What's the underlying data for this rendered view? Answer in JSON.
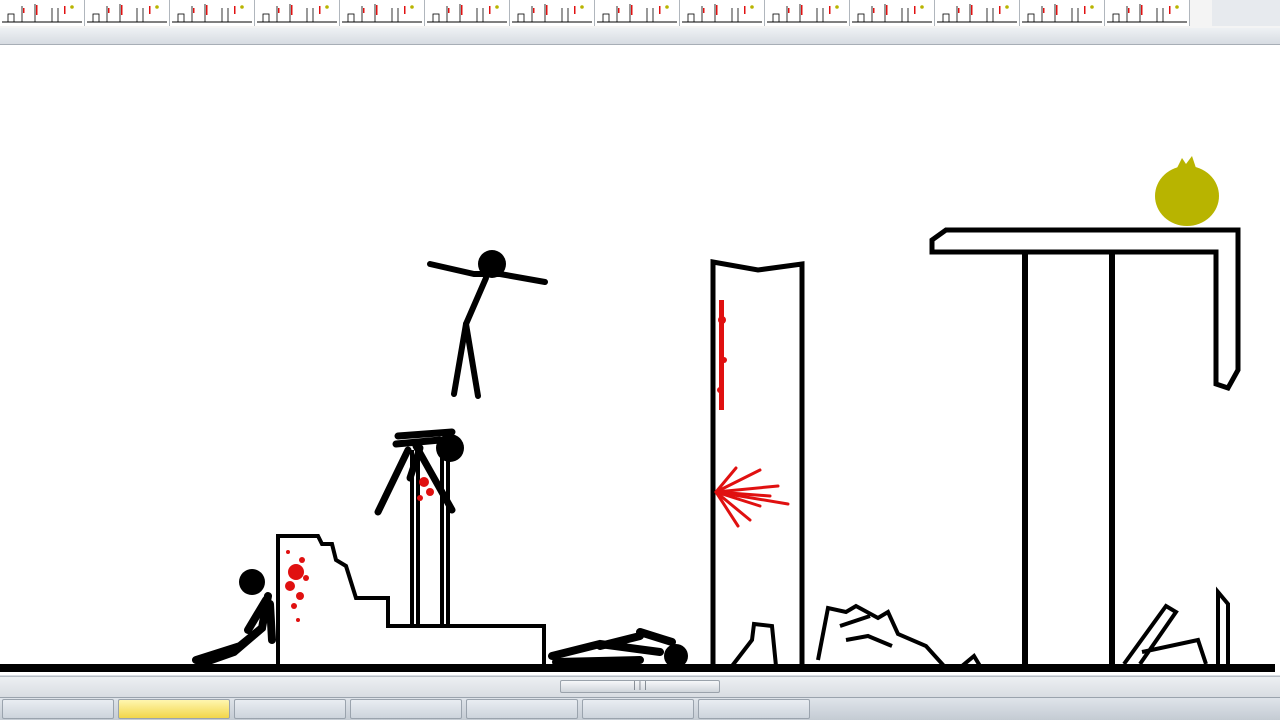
{
  "window": {
    "canvas_background": "#ffffff",
    "chrome_color": "#d8dde3"
  },
  "timeline": {
    "frame_count": 14,
    "frame_icon": "stickfigure-thumbnail-icon"
  },
  "scene": {
    "ink_color": "#000000",
    "blood_color": "#e01010",
    "bag_color": "#b8b400",
    "bag_icon": "money-bag-icon"
  },
  "scrollbar": {
    "grip_label": "|||"
  },
  "taskbar": {
    "task_count": 7
  }
}
